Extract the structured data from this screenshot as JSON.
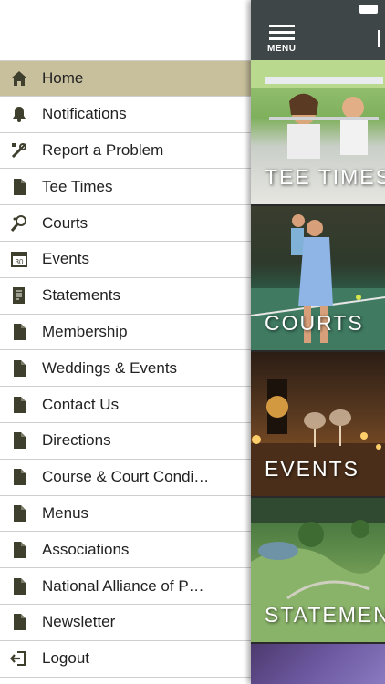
{
  "menu": {
    "items": [
      {
        "label": "Home",
        "icon": "home-icon",
        "active": true
      },
      {
        "label": "Notifications",
        "icon": "bell-icon"
      },
      {
        "label": "Report a Problem",
        "icon": "tools-icon"
      },
      {
        "label": "Tee Times",
        "icon": "document-icon"
      },
      {
        "label": "Courts",
        "icon": "racket-icon"
      },
      {
        "label": "Events",
        "icon": "calendar-icon"
      },
      {
        "label": "Statements",
        "icon": "statement-icon"
      },
      {
        "label": "Membership",
        "icon": "document-icon"
      },
      {
        "label": "Weddings & Events",
        "icon": "document-icon"
      },
      {
        "label": "Contact Us",
        "icon": "document-icon"
      },
      {
        "label": "Directions",
        "icon": "document-icon"
      },
      {
        "label": "Course & Court Condi…",
        "icon": "document-icon"
      },
      {
        "label": "Menus",
        "icon": "document-icon"
      },
      {
        "label": "Associations",
        "icon": "document-icon"
      },
      {
        "label": "National Alliance of P…",
        "icon": "document-icon"
      },
      {
        "label": "Newsletter",
        "icon": "document-icon"
      },
      {
        "label": "Logout",
        "icon": "logout-icon"
      }
    ],
    "calendar_day": "30"
  },
  "header": {
    "menu_label": "MENU"
  },
  "tiles": [
    {
      "label": "TEE TIMES"
    },
    {
      "label": "COURTS"
    },
    {
      "label": "EVENTS"
    },
    {
      "label": "STATEMEN"
    }
  ],
  "colors": {
    "active_row": "#c8bf9c",
    "header_bar": "#3f4647",
    "icon": "#4a4a3a"
  }
}
